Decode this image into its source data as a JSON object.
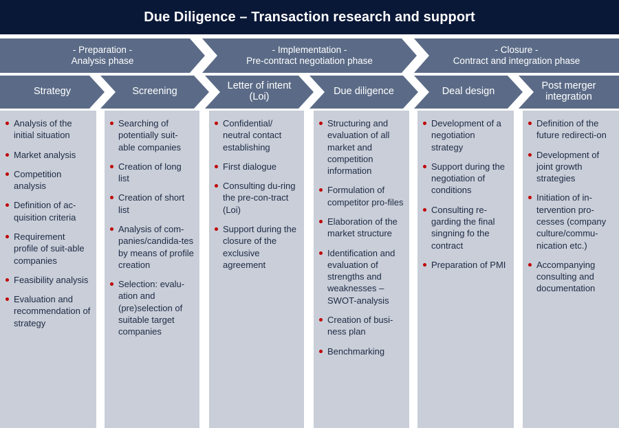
{
  "title": {
    "text": "Due Diligence – Transaction research and support",
    "bar_color": "#0a1838",
    "text_color": "#ffffff"
  },
  "colors": {
    "chevron": "#5b6b87",
    "panel": "#c9ced8",
    "bullet": "#c00000",
    "body_text": "#1d2a44",
    "gap": "#ffffff"
  },
  "phases": [
    {
      "line1": "- Preparation -",
      "line2": "Analysis phase"
    },
    {
      "line1": "- Implementation -",
      "line2": "Pre-contract negotiation phase"
    },
    {
      "line1": "- Closure -",
      "line2": "Contract and integration phase"
    }
  ],
  "steps": [
    {
      "line1": "Strategy",
      "line2": ""
    },
    {
      "line1": "Screening",
      "line2": ""
    },
    {
      "line1": "Letter of intent",
      "line2": "(Loi)"
    },
    {
      "line1": "Due diligence",
      "line2": ""
    },
    {
      "line1": "Deal design",
      "line2": ""
    },
    {
      "line1": "Post merger",
      "line2": "integration"
    }
  ],
  "columns": [
    {
      "name": "strategy",
      "items": [
        "Analysis of the initial situation",
        "Market analysis",
        "Competition analysis",
        "Definition of ac-quisition criteria",
        "Requirement profile of suit-able companies",
        "Feasibility analysis",
        "Evaluation and recommendation of strategy"
      ]
    },
    {
      "name": "screening",
      "items": [
        "Searching of potentially suit-able companies",
        "Creation of long list",
        "Creation of short list",
        "Analysis of com-panies/candida-tes by means of profile creation",
        "Selection: evalu-ation and (pre)selection of suitable target companies"
      ]
    },
    {
      "name": "letter-of-intent",
      "items": [
        "Confidential/ neutral contact establishing",
        "First dialogue",
        "Consulting du-ring the pre-con-tract (Loi)",
        "Support during the closure of the exclusive agreement"
      ]
    },
    {
      "name": "due-diligence",
      "items": [
        "Structuring and evaluation of all market and competition information",
        "Formulation of competitor pro-files",
        "Elaboration of the market structure",
        "Identification and evaluation of strengths and weaknesses – SWOT-analysis",
        "Creation of busi-ness plan",
        "Benchmarking"
      ]
    },
    {
      "name": "deal-design",
      "items": [
        "Development of a negotiation strategy",
        "Support during the negotiation of conditions",
        "Consulting re-garding the final singning fo the contract",
        "Preparation of PMI"
      ]
    },
    {
      "name": "post-merger-integration",
      "items": [
        "Definition of the future redirecti-on",
        "Development of joint growth strategies",
        "Initiation of in-tervention pro-cesses (company culture/commu-nication etc.)",
        "Accompanying consulting and documentation"
      ]
    }
  ]
}
